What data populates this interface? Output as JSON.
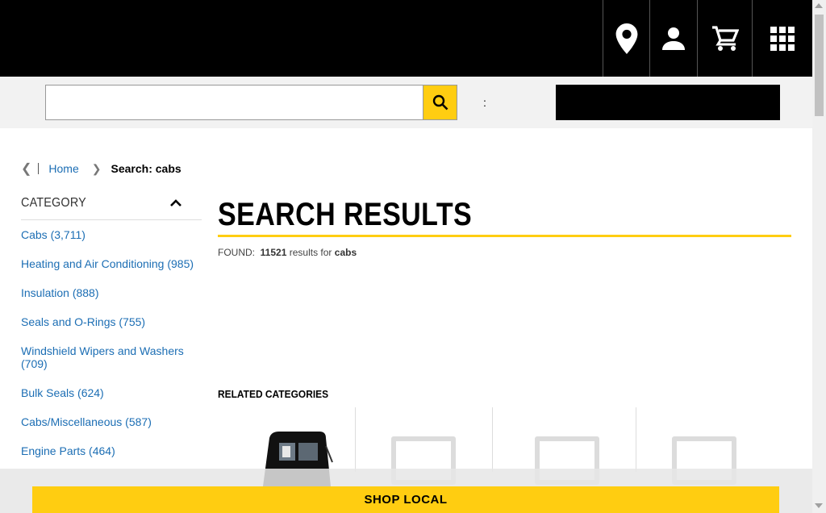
{
  "header": {
    "icons": [
      "location-pin-icon",
      "account-icon",
      "cart-icon",
      "apps-grid-icon"
    ]
  },
  "search": {
    "value": "",
    "placeholder": "",
    "separator": ":"
  },
  "breadcrumb": {
    "home": "Home",
    "current": "Search: cabs"
  },
  "sidebar": {
    "heading": "CATEGORY",
    "items": [
      "Cabs (3,711)",
      "Heating and Air Conditioning (985)",
      "Insulation (888)",
      "Seals and O-Rings (755)",
      "Windshield Wipers and Washers (709)",
      "Bulk Seals (624)",
      "Cabs/Miscellaneous (587)",
      "Engine Parts (464)"
    ]
  },
  "main": {
    "title": "SEARCH RESULTS",
    "found_label": "FOUND:",
    "found_count": "11521",
    "found_mid": "results for",
    "found_query": "cabs",
    "related_heading": "RELATED CATEGORIES"
  },
  "banner": {
    "shop_local": "SHOP LOCAL"
  },
  "colors": {
    "accent": "#ffcd11",
    "link": "#1c6eb4",
    "header_bg": "#000000"
  }
}
